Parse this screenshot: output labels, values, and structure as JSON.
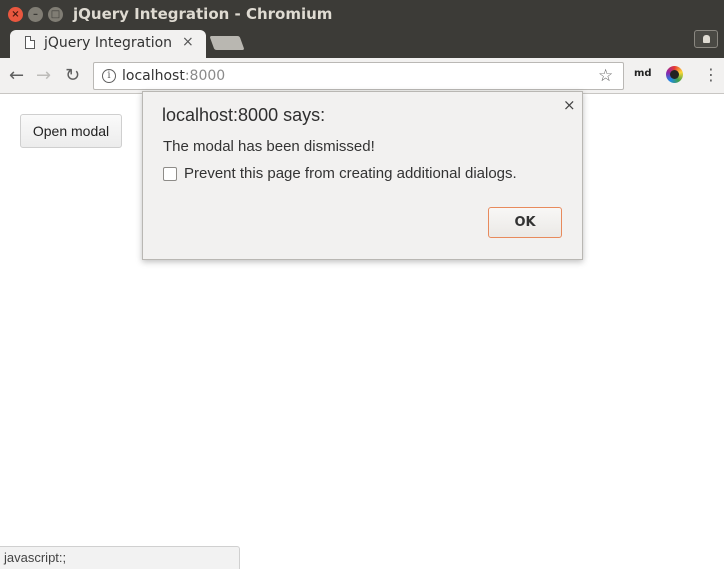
{
  "window": {
    "title": "jQuery Integration - Chromium",
    "controls": {
      "close": "×",
      "minimize": "–",
      "maximize": "□"
    }
  },
  "tab": {
    "title": "jQuery Integration",
    "close": "×"
  },
  "toolbar": {
    "back": "←",
    "forward": "→",
    "reload": "↻",
    "url_host": "localhost",
    "url_port": ":8000",
    "info": "i",
    "star": "☆",
    "ext_md": "md",
    "menu": "⋮"
  },
  "page": {
    "open_modal_label": "Open modal",
    "status_text": "javascript:;"
  },
  "dialog": {
    "title": "localhost:8000 says:",
    "message": "The modal has been dismissed!",
    "checkbox_label": "Prevent this page from creating additional dialogs.",
    "ok_label": "OK",
    "close": "×"
  }
}
